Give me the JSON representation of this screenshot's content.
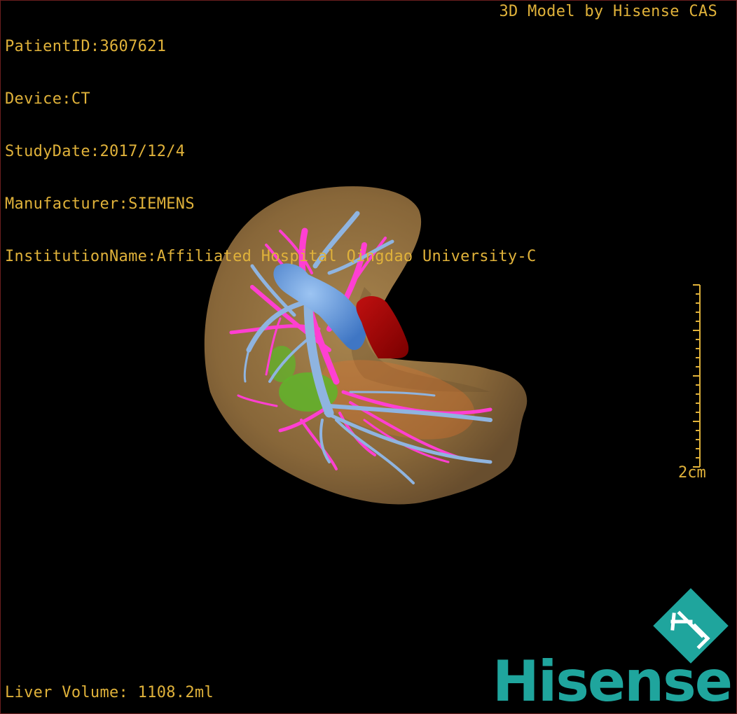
{
  "overlay": {
    "patient_id": "PatientID:3607621",
    "device": "Device:CT",
    "study_date": "StudyDate:2017/12/4",
    "manufacturer": "Manufacturer:SIEMENS",
    "institution": "InstitutionName:Affiliated Hospital Qingdao University-C",
    "model_credit": "3D Model by Hisense CAS",
    "liver_volume": "Liver Volume: 1108.2ml"
  },
  "scale": {
    "label": "2cm"
  },
  "branding": {
    "logo_icon": "hisense-hl-diamond-icon",
    "wordmark": "Hisense",
    "brand_color": "#1fa59d"
  },
  "colors": {
    "text": "#e0b23a",
    "liver": "#a07c45",
    "portal_vein": "#8fb4e0",
    "hepatic_vein": "#ff3fd2",
    "artery": "#a80000",
    "tumor": "#5fb52a",
    "ivc": "#5b8fd8"
  }
}
